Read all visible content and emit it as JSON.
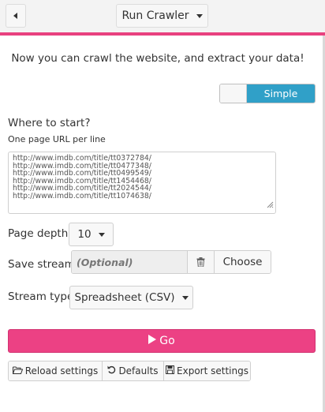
{
  "header": {
    "title": "Run Crawler",
    "back_icon": "chevron-left-icon",
    "accent_color": "#e8417f"
  },
  "intro": {
    "text": "Now you can crawl the website, and extract your data!"
  },
  "mode_toggle": {
    "active_label": "Simple",
    "active_color": "#30a0c8"
  },
  "start": {
    "label": "Where to start?",
    "hint": "One page URL per line",
    "urls": [
      "http://www.imdb.com/title/tt0372784/",
      "http://www.imdb.com/title/tt0477348/",
      "http://www.imdb.com/title/tt0499549/",
      "http://www.imdb.com/title/tt1454468/",
      "http://www.imdb.com/title/tt2024544/",
      "http://www.imdb.com/title/tt1074638/"
    ]
  },
  "page_depth": {
    "label": "Page depth",
    "value": "10"
  },
  "save_stream": {
    "label": "Save stream",
    "placeholder": "(Optional)",
    "choose_label": "Choose"
  },
  "stream_type": {
    "label": "Stream type",
    "value": "Spreadsheet (CSV)"
  },
  "go": {
    "label": "Go",
    "color": "#ec4184"
  },
  "footer_buttons": {
    "reload": "Reload settings",
    "defaults": "Defaults",
    "export": "Export settings"
  }
}
